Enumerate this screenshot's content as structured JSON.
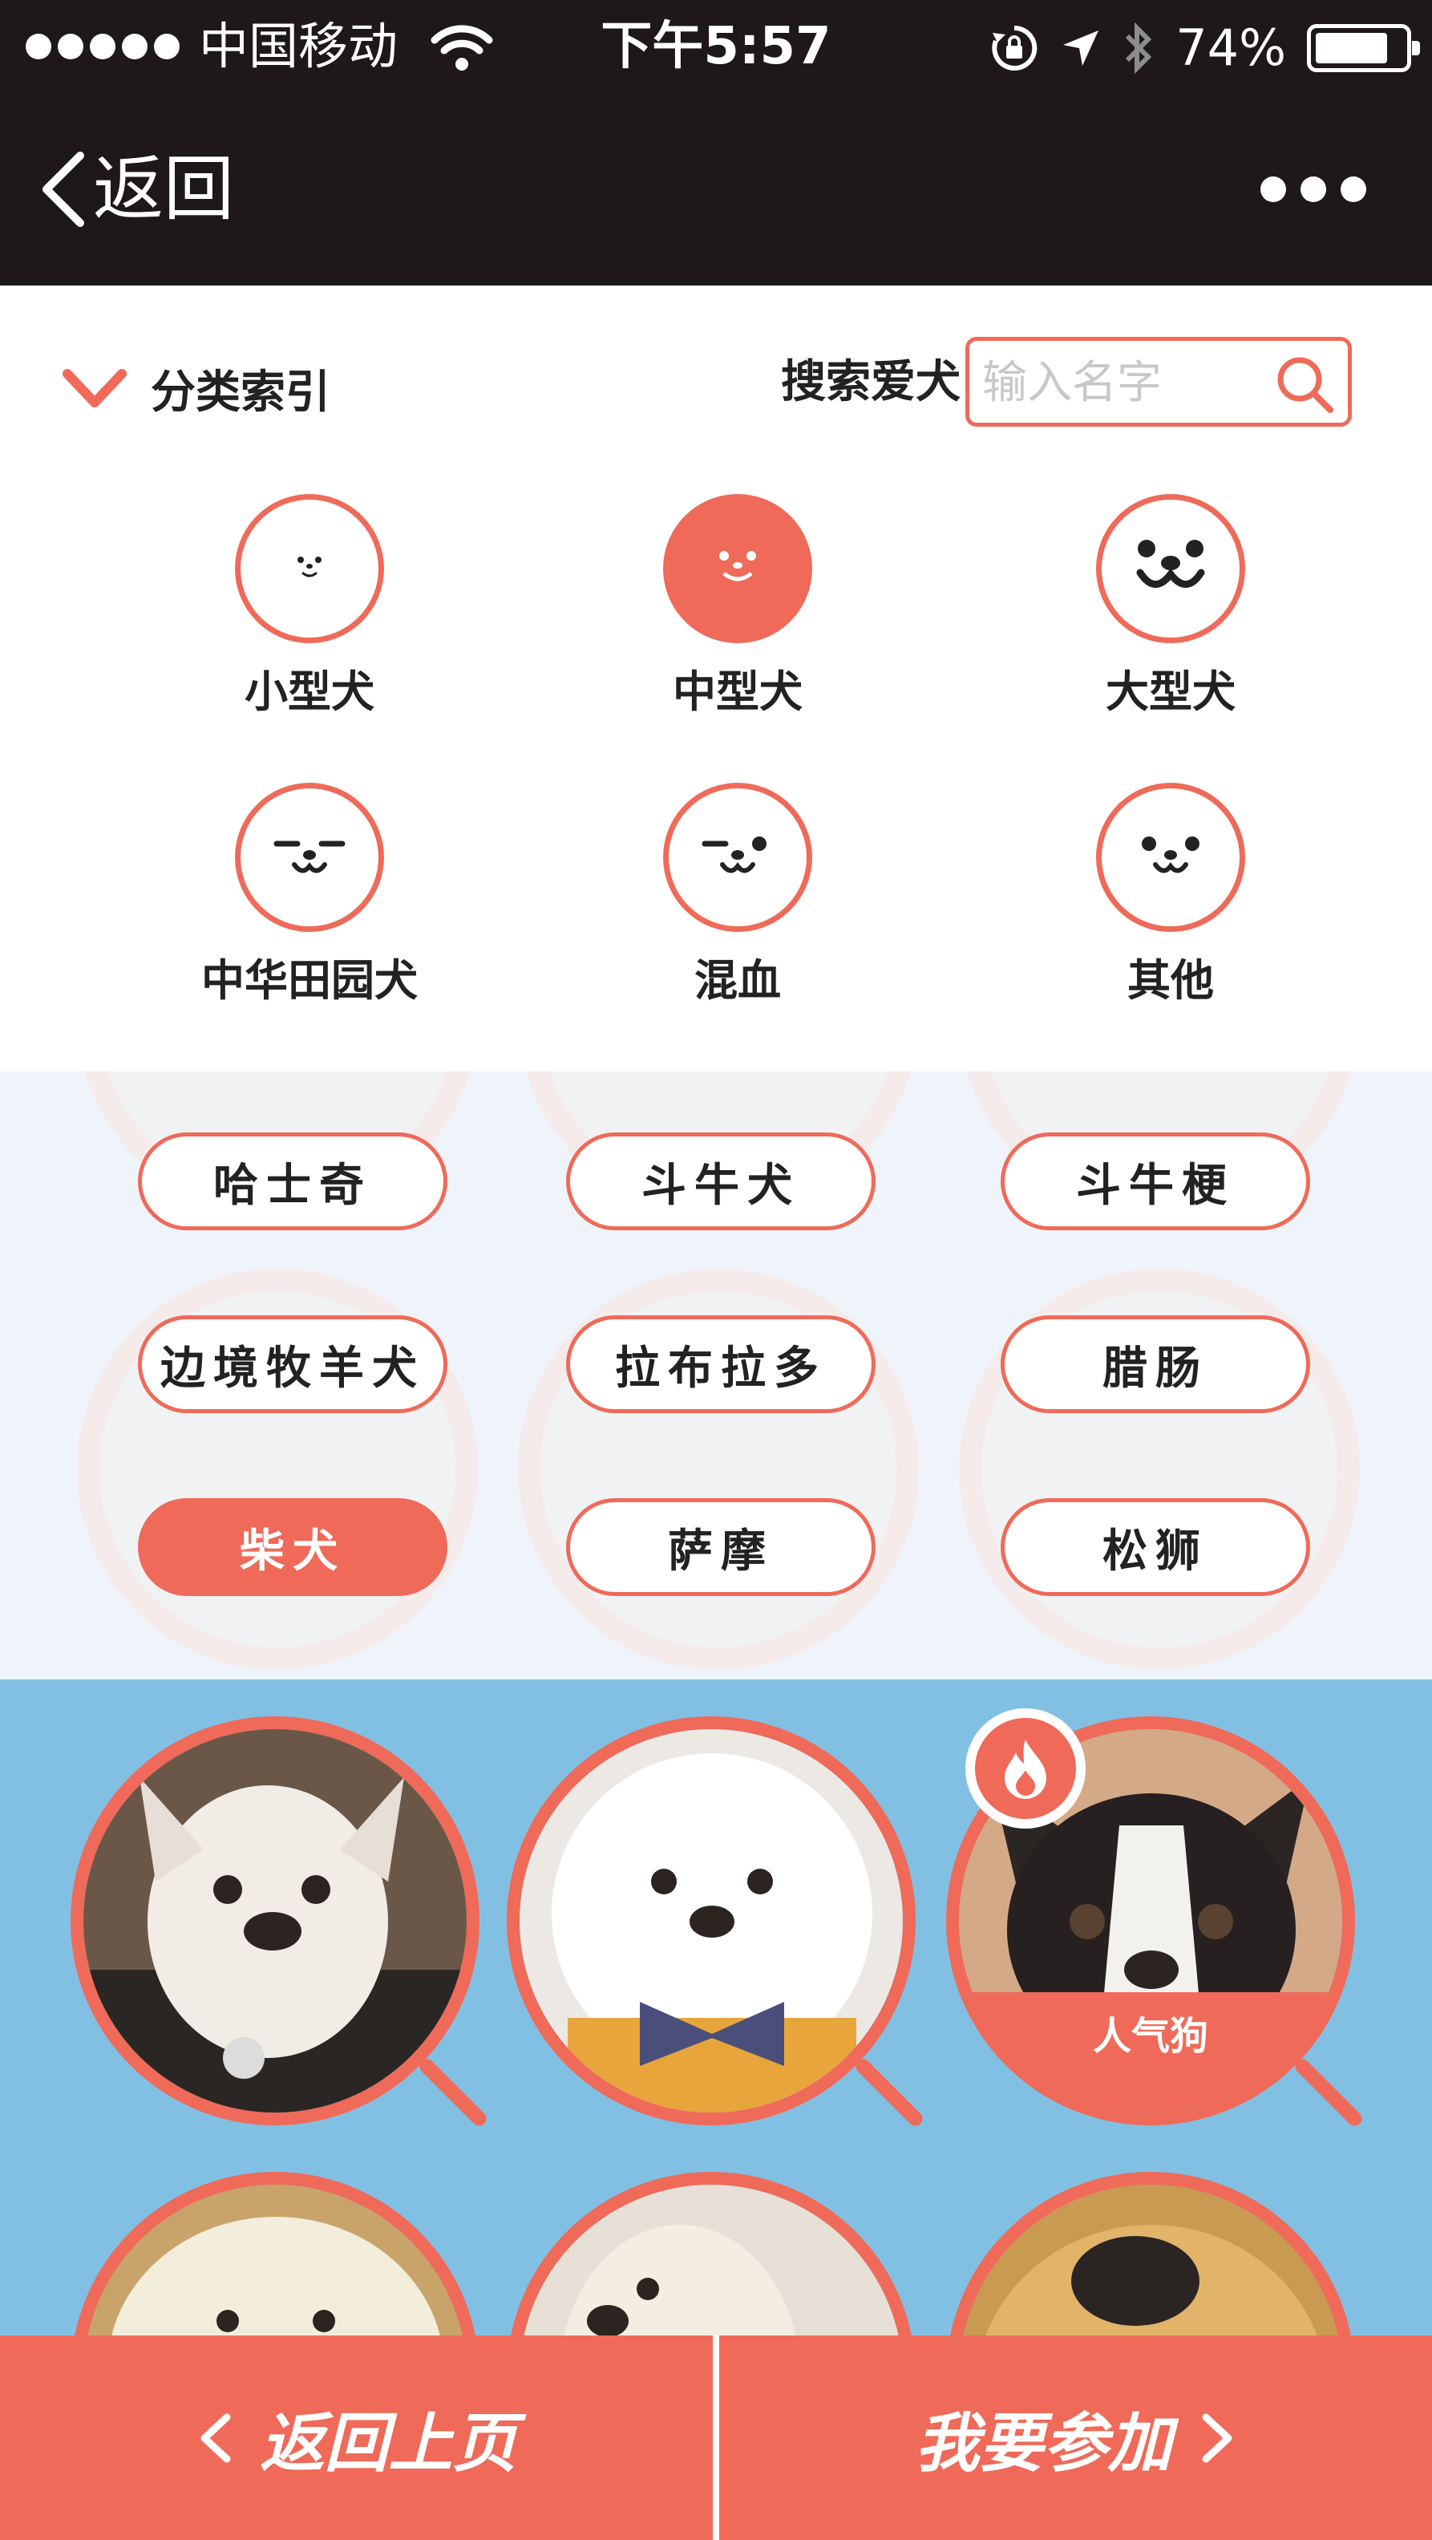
{
  "status_bar": {
    "signal_dots": 5,
    "carrier": "中国移动",
    "time": "下午5:57",
    "battery_pct": "74%",
    "battery_level": 0.74
  },
  "nav": {
    "back_label": "返回"
  },
  "category": {
    "header": "分类索引",
    "search_label": "搜索爱犬",
    "search_placeholder": "输入名字",
    "items": [
      {
        "label": "小型犬",
        "icon": "small-dog-face-icon",
        "active": false
      },
      {
        "label": "中型犬",
        "icon": "medium-dog-face-icon",
        "active": true
      },
      {
        "label": "大型犬",
        "icon": "large-dog-face-icon",
        "active": false
      },
      {
        "label": "中华田园犬",
        "icon": "chinese-dog-face-icon",
        "active": false
      },
      {
        "label": "混血",
        "icon": "mixed-dog-face-icon",
        "active": false
      },
      {
        "label": "其他",
        "icon": "other-dog-face-icon",
        "active": false
      }
    ]
  },
  "breeds": [
    {
      "label": "哈士奇",
      "active": false
    },
    {
      "label": "斗牛犬",
      "active": false
    },
    {
      "label": "斗牛梗",
      "active": false
    },
    {
      "label": "边境牧羊犬",
      "active": false
    },
    {
      "label": "拉布拉多",
      "active": false
    },
    {
      "label": "腊肠",
      "active": false
    },
    {
      "label": "柴犬",
      "active": true
    },
    {
      "label": "萨摩",
      "active": false
    },
    {
      "label": "松狮",
      "active": false
    }
  ],
  "dogs": {
    "popular_label": "人气狗"
  },
  "bottom": {
    "back_label": "返回上页",
    "join_label": "我要参加"
  },
  "colors": {
    "accent": "#ef6a59",
    "topbar": "#1e181d",
    "dog_section_bg": "#82c0e3",
    "breed_section_bg": "#eef4fa"
  }
}
